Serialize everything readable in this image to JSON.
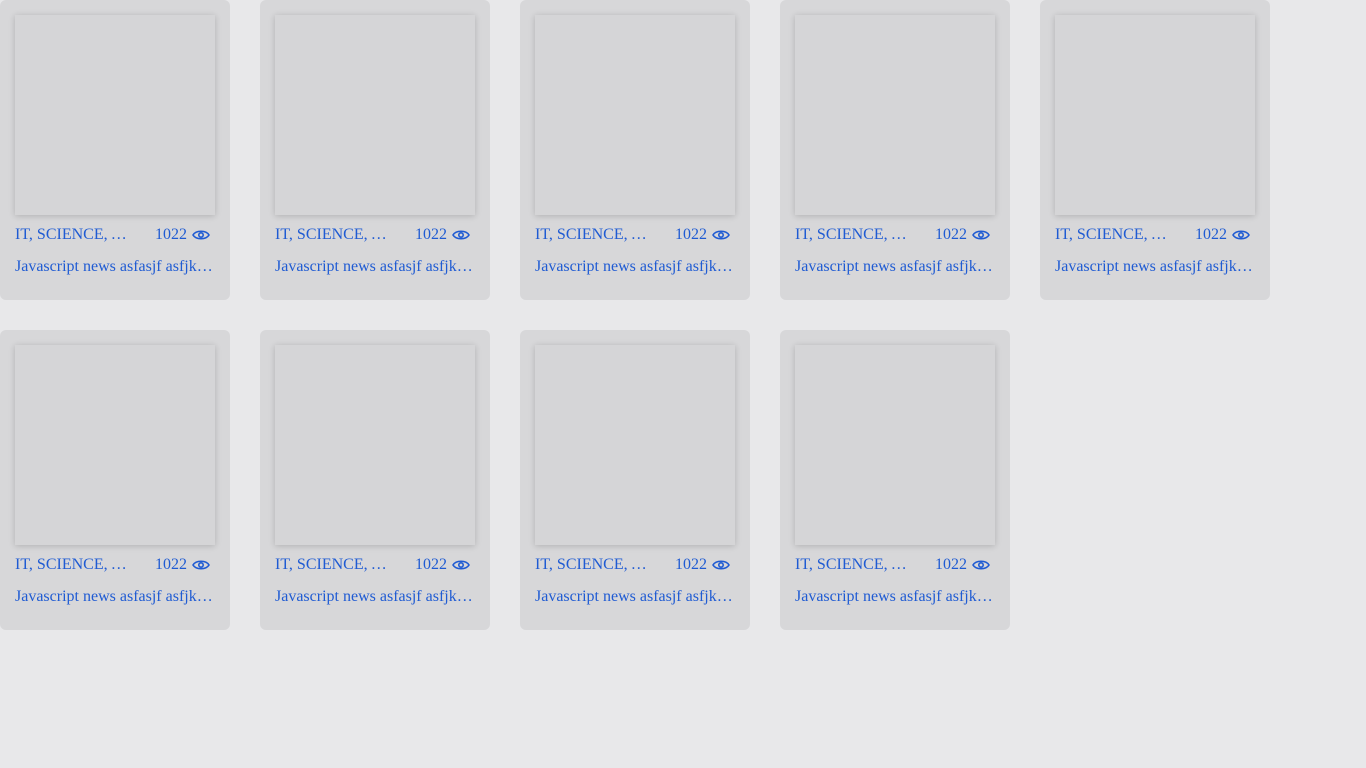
{
  "colors": {
    "background": "#e8e8ea",
    "card": "#d7d7d9",
    "thumbnail": "#d5d5d7",
    "link_text": "#1f5bd3"
  },
  "cards": [
    {
      "tags": "IT, SCIENCE, ANIME",
      "views": "1022",
      "view_icon": "eye-icon",
      "title": "Javascript news asfasjf asfjkasjfkasjf"
    },
    {
      "tags": "IT, SCIENCE, ANIME",
      "views": "1022",
      "view_icon": "eye-icon",
      "title": "Javascript news asfasjf asfjkasjfkasjf"
    },
    {
      "tags": "IT, SCIENCE, ANIME",
      "views": "1022",
      "view_icon": "eye-icon",
      "title": "Javascript news asfasjf asfjkasjfkasjf"
    },
    {
      "tags": "IT, SCIENCE, ANIME",
      "views": "1022",
      "view_icon": "eye-icon",
      "title": "Javascript news asfasjf asfjkasjfkasjf"
    },
    {
      "tags": "IT, SCIENCE, ANIME",
      "views": "1022",
      "view_icon": "eye-icon",
      "title": "Javascript news asfasjf asfjkasjfkasjf"
    },
    {
      "tags": "IT, SCIENCE, ANIME",
      "views": "1022",
      "view_icon": "eye-icon",
      "title": "Javascript news asfasjf asfjkasjfkasjf"
    },
    {
      "tags": "IT, SCIENCE, ANIME",
      "views": "1022",
      "view_icon": "eye-icon",
      "title": "Javascript news asfasjf asfjkasjfkasjf"
    },
    {
      "tags": "IT, SCIENCE, ANIME",
      "views": "1022",
      "view_icon": "eye-icon",
      "title": "Javascript news asfasjf asfjkasjfkasjf"
    },
    {
      "tags": "IT, SCIENCE, ANIME",
      "views": "1022",
      "view_icon": "eye-icon",
      "title": "Javascript news asfasjf asfjkasjfkasjf"
    }
  ]
}
